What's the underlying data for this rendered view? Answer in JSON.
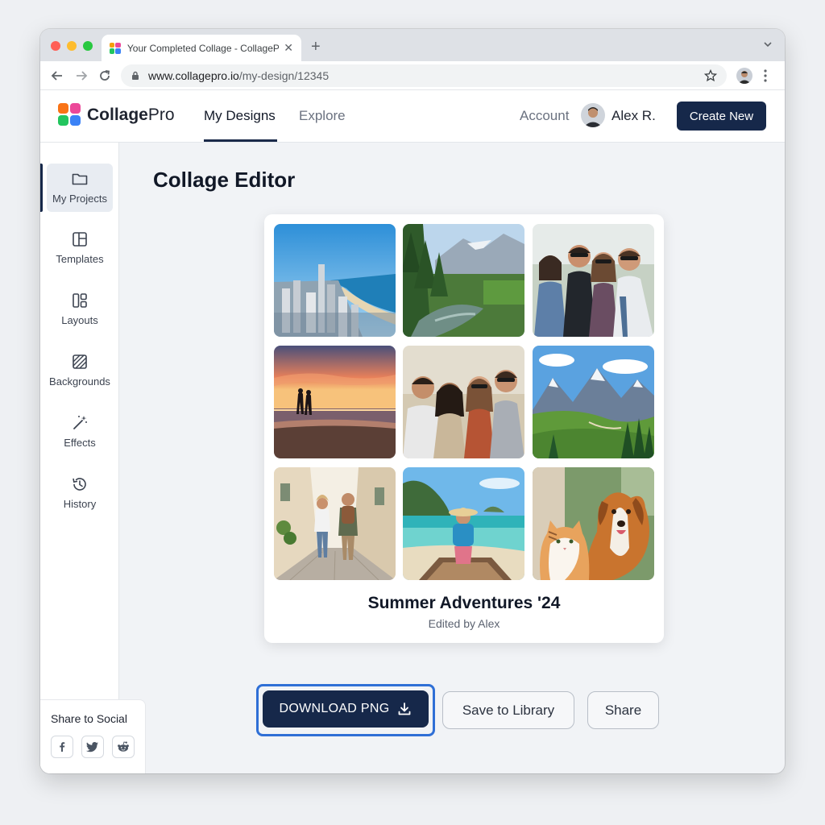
{
  "browser": {
    "tab_title": "Your Completed Collage - CollagePro",
    "tab_close": "✕",
    "new_tab": "+",
    "url_domain": "www.collagepro.io",
    "url_path": "/my-design/12345"
  },
  "header": {
    "brand_bold": "Collage",
    "brand_light": "Pro",
    "nav": [
      "My Designs",
      "Explore"
    ],
    "account_label": "Account",
    "username": "Alex R.",
    "create_button": "Create New"
  },
  "sidebar": {
    "items": [
      {
        "label": "My Projects",
        "icon": "folder-icon",
        "active": true
      },
      {
        "label": "Templates",
        "icon": "template-icon"
      },
      {
        "label": "Layouts",
        "icon": "layout-icon"
      },
      {
        "label": "Backgrounds",
        "icon": "background-icon"
      },
      {
        "label": "Effects",
        "icon": "magic-wand-icon"
      },
      {
        "label": "History",
        "icon": "history-icon"
      }
    ],
    "share": {
      "title": "Share to Social",
      "networks": [
        "facebook-icon",
        "twitter-icon",
        "reddit-icon"
      ]
    }
  },
  "main": {
    "title": "Collage Editor",
    "collage": {
      "title": "Summer Adventures '24",
      "subtitle": "Edited by Alex",
      "photos": [
        "city-beach-photo",
        "forest-river-photo",
        "friends-group-photo",
        "sunset-beach-couple-photo",
        "friends-laughing-photo",
        "mountain-valley-photo",
        "street-travelers-photo",
        "tropical-boat-photo",
        "cat-and-dog-photo"
      ]
    },
    "actions": {
      "download": "DOWNLOAD PNG",
      "save": "Save to Library",
      "share": "Share"
    }
  },
  "colors": {
    "primary": "#16284a",
    "focus_ring": "#2f6fd6",
    "page_bg": "#eef0f3"
  }
}
